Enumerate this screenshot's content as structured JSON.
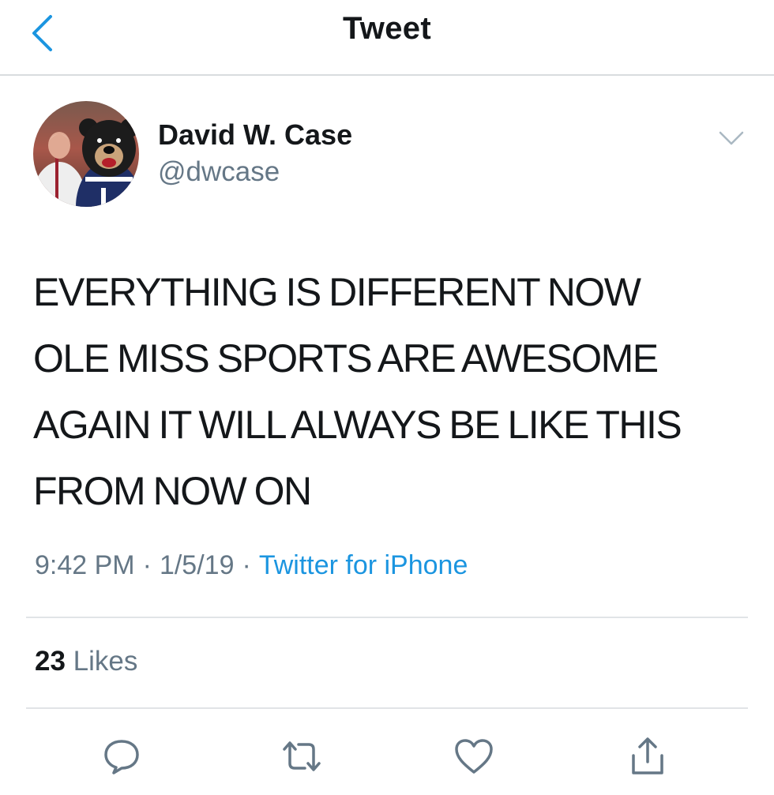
{
  "header": {
    "title": "Tweet",
    "back_icon": "chevron-left-icon"
  },
  "tweet": {
    "author_name": "David W. Case",
    "author_handle": "@dwcase",
    "text_lines": [
      "EVERYTHING IS DIFFERENT NOW",
      "OLE MISS SPORTS ARE AWESOME",
      "AGAIN IT WILL ALWAYS BE LIKE THIS",
      "FROM NOW ON"
    ],
    "time": "9:42 PM",
    "date": "1/5/19",
    "separator": "·",
    "source": "Twitter for iPhone",
    "likes_count": "23",
    "likes_label": "Likes"
  },
  "actions": [
    "reply-icon",
    "retweet-icon",
    "like-icon",
    "share-icon"
  ],
  "colors": {
    "accent": "#1b95e0",
    "text": "#14171a",
    "secondary": "#657786",
    "divider": "#e1e4e7"
  }
}
